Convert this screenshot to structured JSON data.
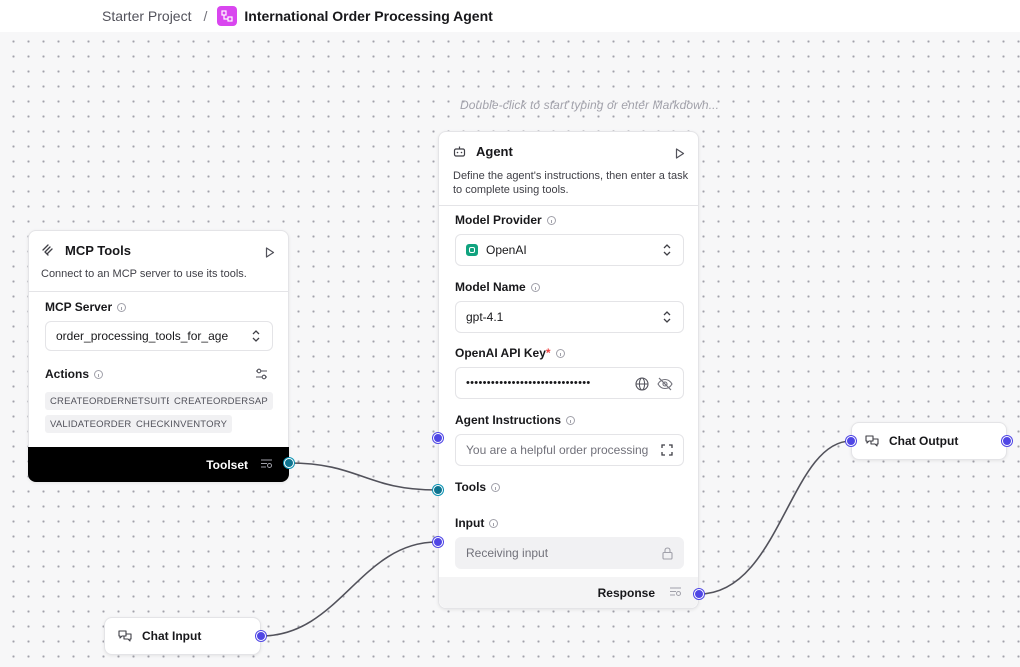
{
  "breadcrumb": {
    "project": "Starter Project",
    "separator": "/",
    "flow_title": "International Order Processing Agent"
  },
  "canvas": {
    "hint": "Double-click to start typing or enter Markdown..."
  },
  "mcp_tools": {
    "title": "MCP Tools",
    "description": "Connect to an MCP server to use its tools.",
    "server_label": "MCP Server",
    "server_value": "order_processing_tools_for_age",
    "actions_label": "Actions",
    "actions": [
      "CREATEORDERNETSUITE",
      "CREATEORDERSAP",
      "VALIDATEORDER",
      "CHECKINVENTORY"
    ],
    "output_label": "Toolset"
  },
  "agent": {
    "title": "Agent",
    "description_line1": "Define the agent's instructions, then enter a task",
    "description_line2": "to complete using tools.",
    "model_provider_label": "Model Provider",
    "model_provider_value": "OpenAI",
    "model_name_label": "Model Name",
    "model_name_value": "gpt-4.1",
    "api_key_label": "OpenAI API Key",
    "api_key_required": "*",
    "api_key_value": "••••••••••••••••••••••••••••••",
    "instructions_label": "Agent Instructions",
    "instructions_value": "You are a helpful order processing",
    "tools_label": "Tools",
    "input_label": "Input",
    "input_placeholder": "Receiving input",
    "output_label": "Response"
  },
  "chat_output": {
    "title": "Chat Output"
  },
  "chat_input": {
    "title": "Chat Input"
  },
  "colors": {
    "accent": "#4f46e5",
    "tool_handle": "#0e7490",
    "openai_badge": "#10a37f",
    "breadcrumb_icon": "#d946ef"
  }
}
